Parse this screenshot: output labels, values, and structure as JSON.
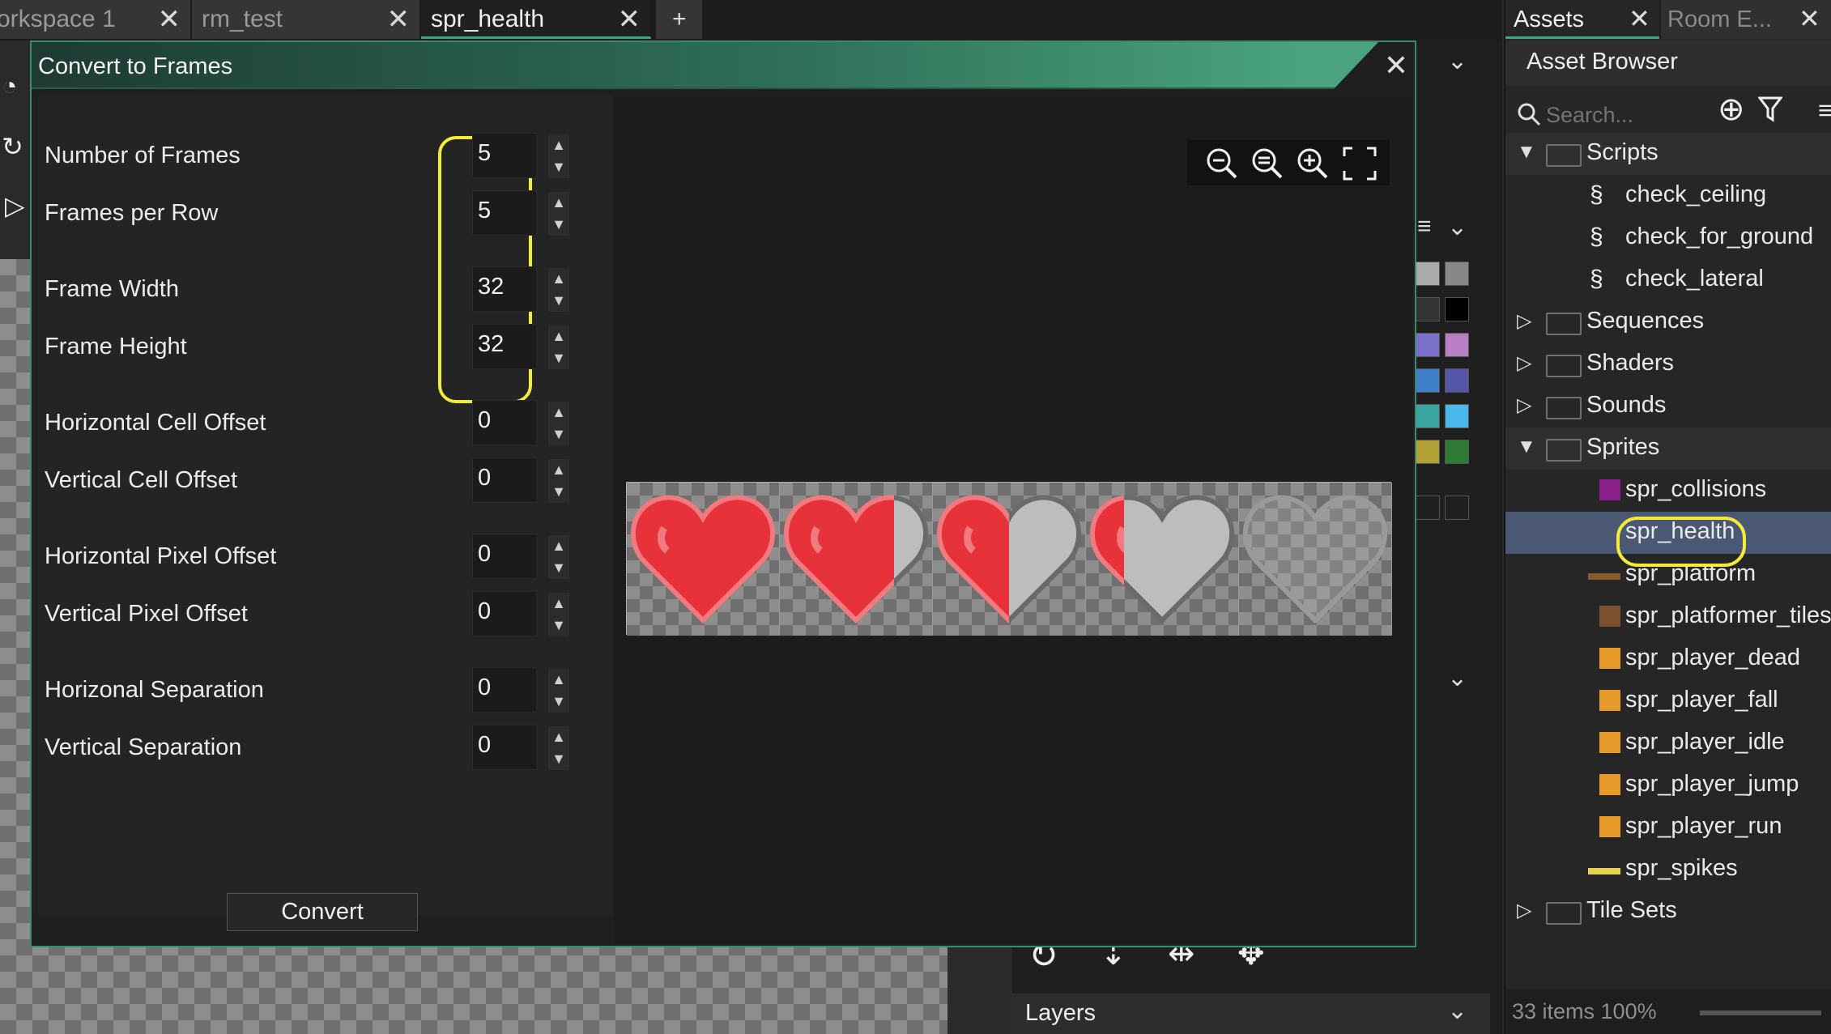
{
  "tabs": [
    {
      "label": "orkspace 1",
      "active": false
    },
    {
      "label": "rm_test",
      "active": false
    },
    {
      "label": "spr_health",
      "active": true
    }
  ],
  "tabs_add_label": "+",
  "tab_close_glyph": "✕",
  "dialog": {
    "title": "Convert to Frames",
    "close_glyph": "✕",
    "fields": [
      {
        "label": "Number of Frames",
        "value": "5"
      },
      {
        "label": "Frames per Row",
        "value": "5"
      },
      {
        "label": "Frame Width",
        "value": "32"
      },
      {
        "label": "Frame Height",
        "value": "32"
      },
      {
        "label": "Horizontal Cell Offset",
        "value": "0"
      },
      {
        "label": "Vertical Cell Offset",
        "value": "0"
      },
      {
        "label": "Horizontal Pixel Offset",
        "value": "0"
      },
      {
        "label": "Vertical Pixel Offset",
        "value": "0"
      },
      {
        "label": "Horizonal Separation",
        "value": "0"
      },
      {
        "label": "Vertical Separation",
        "value": "0"
      }
    ],
    "convert_label": "Convert",
    "zoom_icons": [
      "zoom-out-icon",
      "zoom-reset-icon",
      "zoom-in-icon",
      "fit-screen-icon"
    ],
    "preview_frames": [
      {
        "fill_fraction": 1.0
      },
      {
        "fill_fraction": 0.75
      },
      {
        "fill_fraction": 0.5
      },
      {
        "fill_fraction": 0.25
      },
      {
        "fill_fraction": 0.0
      }
    ],
    "colors": {
      "heart_red": "#e8323a",
      "heart_outline": "#f07a7f",
      "heart_empty": "#bdbdbd",
      "highlight": "#f3ea3a",
      "accent": "#3fa779"
    }
  },
  "assets": {
    "tabs": [
      {
        "label": "Assets"
      },
      {
        "label": "Room E..."
      }
    ],
    "header": "Asset Browser",
    "search_placeholder": "Search...",
    "tree": [
      {
        "label": "Scripts",
        "kind": "folder",
        "expanded": true
      },
      {
        "label": "check_ceiling",
        "kind": "script"
      },
      {
        "label": "check_for_ground",
        "kind": "script"
      },
      {
        "label": "check_lateral",
        "kind": "script"
      },
      {
        "label": "Sequences",
        "kind": "folder",
        "expanded": false
      },
      {
        "label": "Shaders",
        "kind": "folder",
        "expanded": false
      },
      {
        "label": "Sounds",
        "kind": "folder",
        "expanded": false
      },
      {
        "label": "Sprites",
        "kind": "folder",
        "expanded": true
      },
      {
        "label": "spr_collisions",
        "kind": "sprite"
      },
      {
        "label": "spr_health",
        "kind": "sprite",
        "selected": true
      },
      {
        "label": "spr_platform",
        "kind": "sprite"
      },
      {
        "label": "spr_platformer_tiles",
        "kind": "sprite"
      },
      {
        "label": "spr_player_dead",
        "kind": "sprite"
      },
      {
        "label": "spr_player_fall",
        "kind": "sprite"
      },
      {
        "label": "spr_player_idle",
        "kind": "sprite"
      },
      {
        "label": "spr_player_jump",
        "kind": "sprite"
      },
      {
        "label": "spr_player_run",
        "kind": "sprite"
      },
      {
        "label": "spr_spikes",
        "kind": "sprite"
      },
      {
        "label": "Tile Sets",
        "kind": "folder",
        "expanded": false
      }
    ],
    "status_text": "33 items  100%"
  },
  "layers_label": "Layers"
}
